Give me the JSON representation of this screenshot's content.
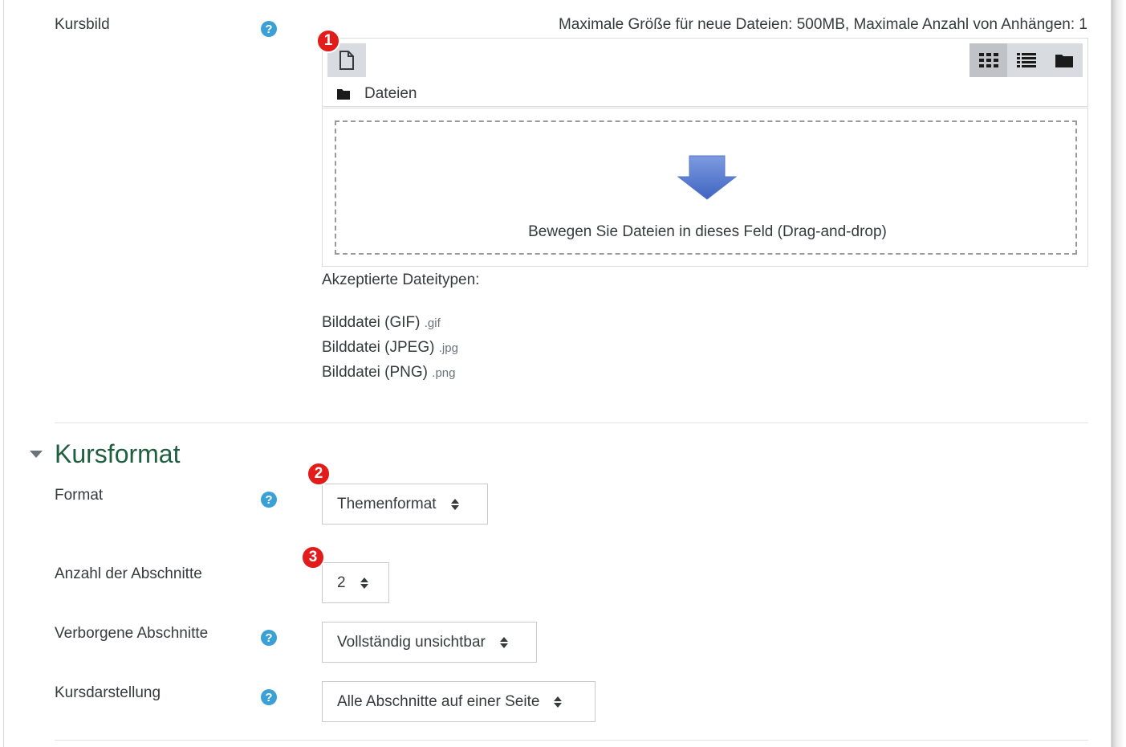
{
  "kursbild": {
    "label": "Kursbild",
    "help": "?",
    "max_info": "Maximale Größe für neue Dateien: 500MB, Maximale Anzahl von Anhängen: 1",
    "path_label": "Dateien",
    "dropzone_text": "Bewegen Sie Dateien in dieses Feld (Drag-and-drop)",
    "accepted_title": "Akzeptierte Dateitypen:",
    "filetypes": [
      {
        "name": "Bilddatei (GIF)",
        "ext": ".gif"
      },
      {
        "name": "Bilddatei (JPEG)",
        "ext": ".jpg"
      },
      {
        "name": "Bilddatei (PNG)",
        "ext": ".png"
      }
    ],
    "toolbar_icons": [
      "add-file-icon"
    ],
    "view_icons": [
      "grid-view-icon",
      "list-view-icon",
      "folder-view-icon"
    ],
    "active_view": "grid-view-icon"
  },
  "markers": [
    "1",
    "2",
    "3"
  ],
  "kursformat": {
    "title": "Kursformat",
    "fields": [
      {
        "label": "Format",
        "help": "?",
        "value": "Themenformat"
      },
      {
        "label": "Anzahl der Abschnitte",
        "value": "2"
      },
      {
        "label": "Verborgene Abschnitte",
        "help": "?",
        "value": "Vollständig unsichtbar"
      },
      {
        "label": "Kursdarstellung",
        "help": "?",
        "value": "Alle Abschnitte auf einer Seite"
      }
    ]
  },
  "colors": {
    "section_title": "#1f5f3f",
    "help_icon": "#3aa0d6",
    "marker": "#e21b1b",
    "dropzone_arrow": "#5b7fd0"
  }
}
